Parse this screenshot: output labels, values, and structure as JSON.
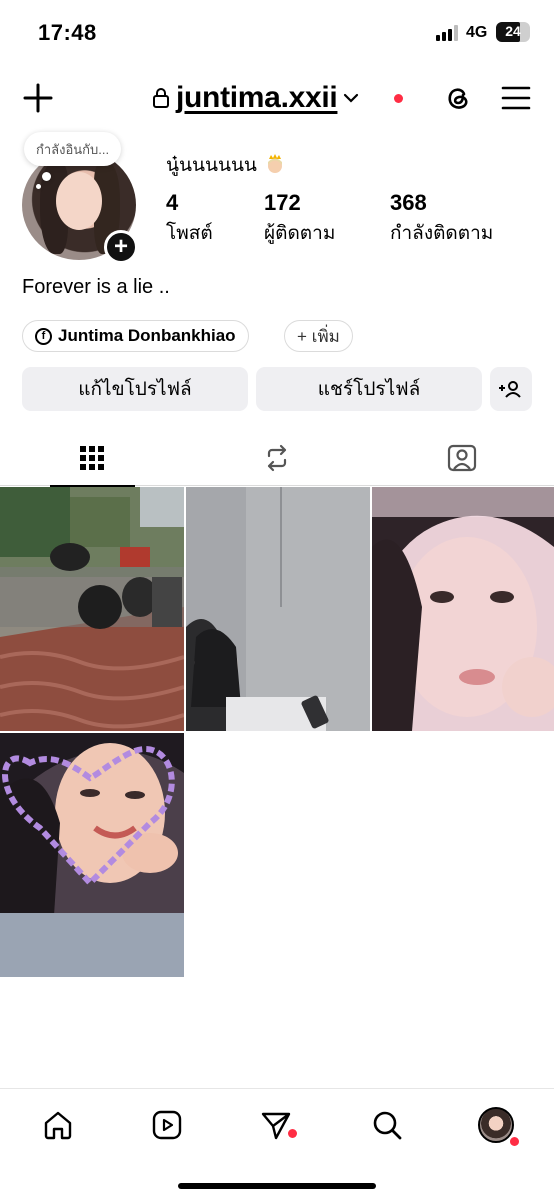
{
  "status_bar": {
    "time": "17:48",
    "network": "4G",
    "battery": "24"
  },
  "header": {
    "username": "juntima.xxii"
  },
  "profile": {
    "note": "กำลังอินกับ...",
    "display_name": "นู๋นนนนนน",
    "stats": [
      {
        "value": "4",
        "label": "โพสต์"
      },
      {
        "value": "172",
        "label": "ผู้ติดตาม"
      },
      {
        "value": "368",
        "label": "กำลังติดตาม"
      }
    ],
    "bio": "Forever is a lie ..",
    "facebook_link": "Juntima Donbankhiao",
    "add_chip": "+ เพิ่ม"
  },
  "actions": {
    "edit_profile": "แก้ไขโปรไฟล์",
    "share_profile": "แชร์โปรไฟล์"
  },
  "tabs": [
    {
      "icon": "grid-icon",
      "active": true
    },
    {
      "icon": "reposts-icon",
      "active": false
    },
    {
      "icon": "tagged-icon",
      "active": false
    }
  ],
  "posts": [
    {
      "description_icon": "photo-thumbnail"
    },
    {
      "description_icon": "photo-thumbnail"
    },
    {
      "description_icon": "photo-thumbnail"
    },
    {
      "description_icon": "photo-thumbnail"
    }
  ],
  "bottom_nav": [
    {
      "icon": "home-icon"
    },
    {
      "icon": "reels-icon"
    },
    {
      "icon": "send-icon",
      "badge": true
    },
    {
      "icon": "search-icon"
    },
    {
      "icon": "profile-icon",
      "badge": true
    }
  ],
  "colors": {
    "accent_badge": "#ff2d44",
    "button_bg": "#efeff2",
    "border": "#dbdbdb"
  }
}
